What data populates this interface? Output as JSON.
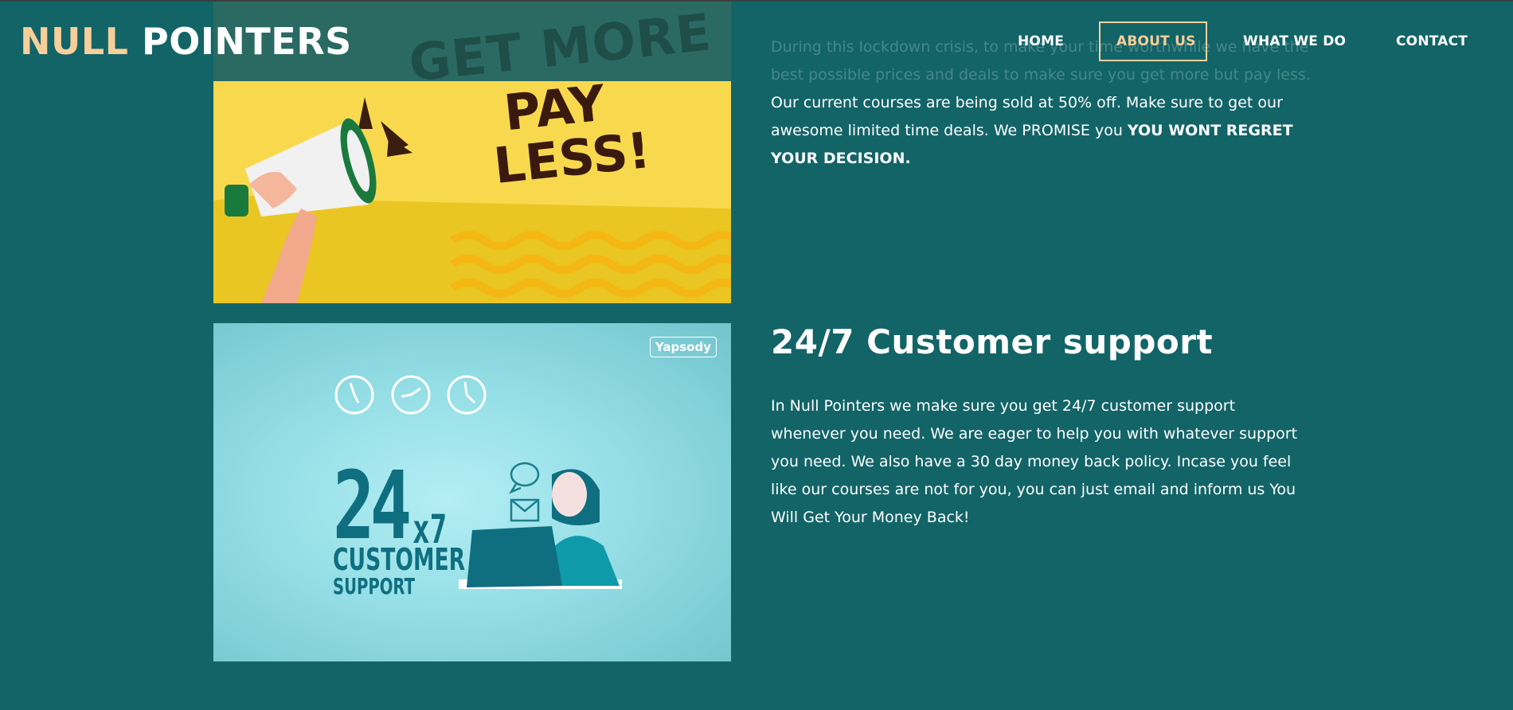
{
  "brand": {
    "part1": "NULL",
    "part2": "POINTERS",
    "accent_color": "#f7cf9b"
  },
  "nav": {
    "items": [
      {
        "label": "HOME",
        "active": false
      },
      {
        "label": "ABOUT US",
        "active": true
      },
      {
        "label": "WHAT WE DO",
        "active": false
      },
      {
        "label": "CONTACT",
        "active": false
      }
    ]
  },
  "colors": {
    "background": "#126467",
    "text": "#ffffff"
  },
  "section_deals": {
    "image": {
      "icon": "megaphone-icon",
      "headline_top": "GET MORE",
      "headline_line1": "PAY",
      "headline_line2": "LESS!"
    },
    "faded_text": "During this lockdown crisis, to make your time worthwhile we have the best possible prices and deals to make sure you get more but pay less.",
    "text": "Our current courses are being sold at 50% off. Make sure to get our awesome limited time deals. We PROMISE you",
    "emphasis": "YOU WONT REGRET YOUR DECISION."
  },
  "section_support": {
    "title": "24/7 Customer support",
    "image": {
      "icon": "customer-support-agent-icon",
      "badge": "Yapsody",
      "big_number": "24",
      "multiplier": "x7",
      "caption_line1": "CUSTOMER",
      "caption_line2": "SUPPORT"
    },
    "text": "In Null Pointers we make sure you get 24/7 customer support whenever you need. We are eager to help you with whatever support you need. We also have a 30 day money back policy. Incase you feel like our courses are not for you, you can just email and inform us You Will Get Your Money Back!"
  }
}
